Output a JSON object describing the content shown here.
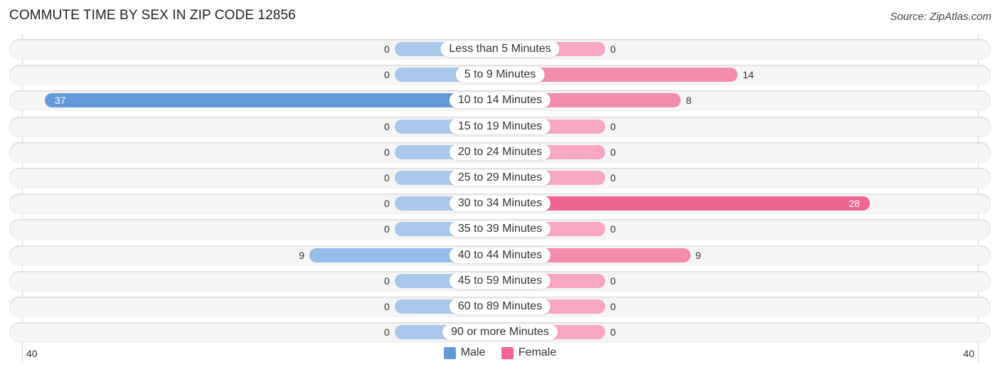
{
  "chart_data": {
    "type": "bar",
    "orientation": "horizontal-diverging",
    "title": "COMMUTE TIME BY SEX IN ZIP CODE 12856",
    "source": "Source: ZipAtlas.com",
    "categories": [
      "Less than 5 Minutes",
      "5 to 9 Minutes",
      "10 to 14 Minutes",
      "15 to 19 Minutes",
      "20 to 24 Minutes",
      "25 to 29 Minutes",
      "30 to 34 Minutes",
      "35 to 39 Minutes",
      "40 to 44 Minutes",
      "45 to 59 Minutes",
      "60 to 89 Minutes",
      "90 or more Minutes"
    ],
    "series": [
      {
        "name": "Male",
        "color": "#6399d9",
        "light_color": "#a9c8ec",
        "values": [
          0,
          0,
          37,
          0,
          0,
          0,
          0,
          0,
          9,
          0,
          0,
          0
        ]
      },
      {
        "name": "Female",
        "color": "#f06691",
        "light_color": "#f7a8c0",
        "values": [
          0,
          14,
          8,
          0,
          0,
          0,
          28,
          0,
          9,
          0,
          0,
          0
        ]
      }
    ],
    "axis": {
      "left_label": "40",
      "right_label": "40",
      "max": 40
    },
    "legend": {
      "position": "bottom-center",
      "items": [
        "Male",
        "Female"
      ]
    }
  }
}
